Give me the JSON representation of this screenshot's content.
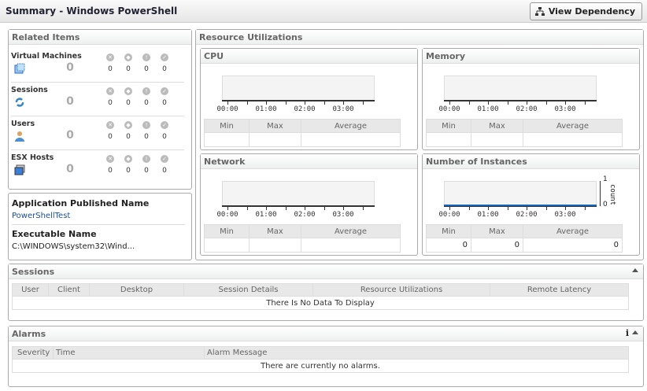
{
  "header": {
    "title": "Summary  - Windows PowerShell",
    "view_dependency": "View Dependency"
  },
  "related": {
    "title": "Related Items",
    "items": [
      {
        "name": "Virtual Machines",
        "count": "0",
        "critical": "0",
        "major": "0",
        "warning": "0",
        "normal": "0"
      },
      {
        "name": "Sessions",
        "count": "0",
        "critical": "0",
        "major": "0",
        "warning": "0",
        "normal": "0"
      },
      {
        "name": "Users",
        "count": "0",
        "critical": "0",
        "major": "0",
        "warning": "0",
        "normal": "0"
      },
      {
        "name": "ESX Hosts",
        "count": "0",
        "critical": "0",
        "major": "0",
        "warning": "0",
        "normal": "0"
      }
    ]
  },
  "app": {
    "published_label": "Application Published Name",
    "published_value": "PowerShellTest",
    "exe_label": "Executable Name",
    "exe_value": "C:\\WINDOWS\\system32\\Wind..."
  },
  "resource": {
    "title": "Resource Utilizations",
    "ticks": [
      "00:00",
      "01:00",
      "02:00",
      "03:00"
    ],
    "cols": [
      "Min",
      "Max",
      "Average"
    ],
    "cpu": {
      "title": "CPU",
      "min": "",
      "max": "",
      "avg": ""
    },
    "memory": {
      "title": "Memory",
      "min": "",
      "max": "",
      "avg": ""
    },
    "network": {
      "title": "Network",
      "min": "",
      "max": "",
      "avg": ""
    },
    "instances": {
      "title": "Number of Instances",
      "min": "0",
      "max": "0",
      "avg": "0",
      "y_label": "count",
      "y_max": "1",
      "y_min": "0"
    }
  },
  "sessions": {
    "title": "Sessions",
    "cols": [
      "User",
      "Client",
      "Desktop",
      "Session Details",
      "Resource Utilizations",
      "Remote Latency"
    ],
    "empty": "There Is No Data To Display"
  },
  "alarms": {
    "title": "Alarms",
    "cols": [
      "Severity",
      "Time",
      "Alarm Message"
    ],
    "empty": "There are currently no alarms."
  },
  "colors": {
    "series": "#1565c0"
  }
}
